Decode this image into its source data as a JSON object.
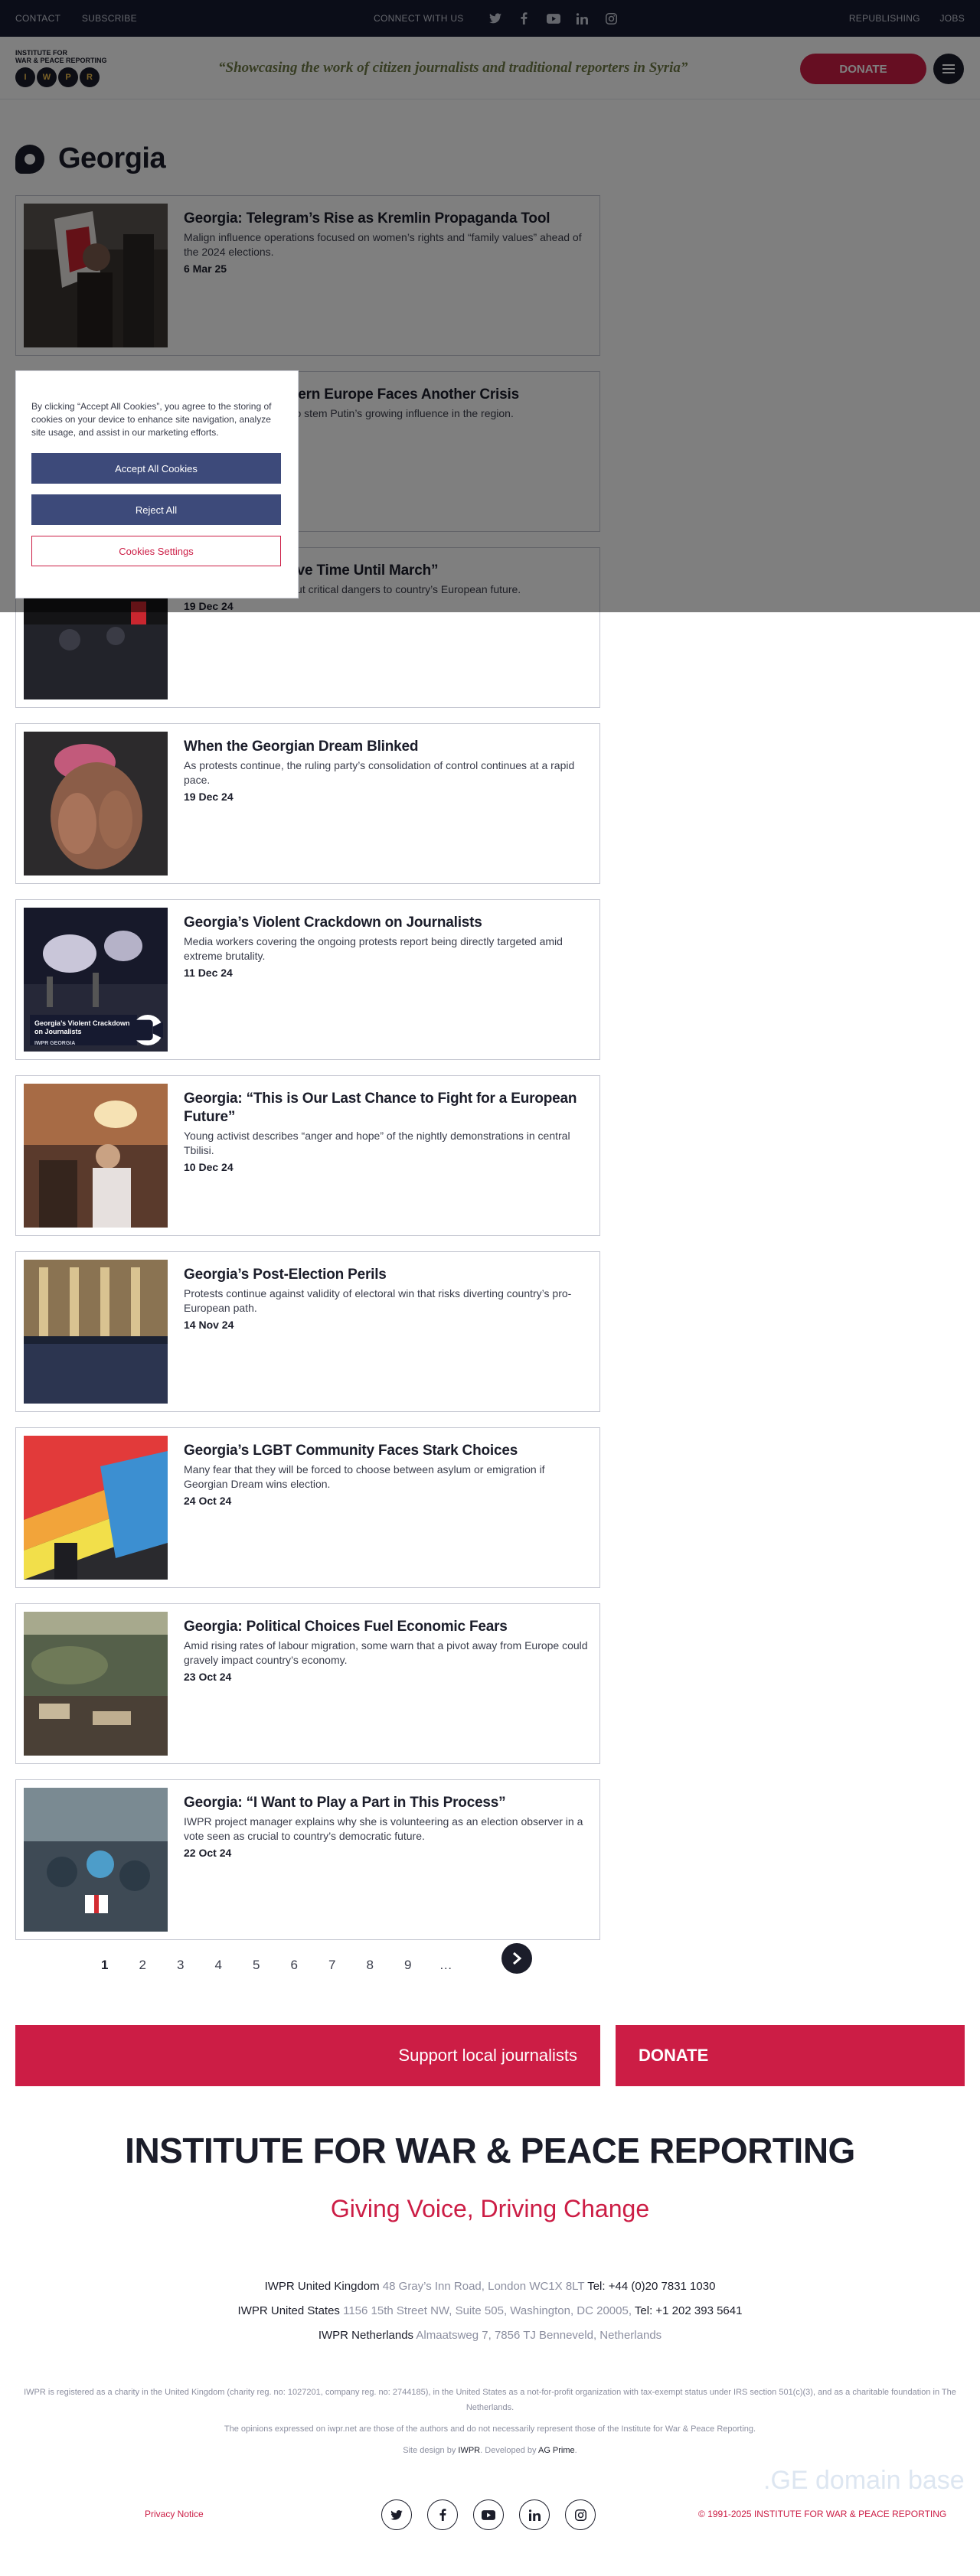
{
  "topbar": {
    "contact": "CONTACT",
    "subscribe": "SUBSCRIBE",
    "connect": "CONNECT WITH US",
    "republishing": "REPUBLISHING",
    "jobs": "JOBS"
  },
  "header": {
    "logo_line1": "INSTITUTE FOR",
    "logo_line2": "WAR & PEACE REPORTING",
    "logo_letters": [
      "I",
      "W",
      "P",
      "R"
    ],
    "tagline": "“Showcasing the work of citizen journalists and traditional reporters in Syria”",
    "donate": "DONATE"
  },
  "page": {
    "title": "Georgia"
  },
  "articles": [
    {
      "title": "Georgia: Telegram’s Rise as Kremlin Propaganda Tool",
      "summary": "Malign influence operations focused on women’s rights and “family values” ahead of the 2024 elections.",
      "date": "6 Mar 25"
    },
    {
      "title": "Georgia: As Eastern Europe Faces Another Crisis",
      "summary": "Local actors are trying to stem Putin’s growing influence in the region.",
      "date": ""
    },
    {
      "title": "Georgia: “We Have Time Until March”",
      "summary": "Former president lays out critical dangers to country’s European future.",
      "date": "19 Dec 24"
    },
    {
      "title": "When the Georgian Dream Blinked",
      "summary": "As protests continue, the ruling party’s consolidation of control continues at a rapid pace.",
      "date": "19 Dec 24"
    },
    {
      "title": "Georgia’s Violent Crackdown on Journalists",
      "summary": "Media workers covering the ongoing protests report being directly targeted amid extreme brutality.",
      "date": "11 Dec 24",
      "video_label": "Georgia’s Violent Crackdown on Journalists",
      "video_sub": "IWPR GEORGIA"
    },
    {
      "title": "Georgia: “This is Our Last Chance to Fight for a European Future”",
      "summary": "Young activist describes “anger and hope” of the nightly demonstrations in central Tbilisi.",
      "date": "10 Dec 24"
    },
    {
      "title": "Georgia’s Post-Election Perils",
      "summary": "Protests continue against validity of electoral win that risks diverting country’s pro-European path.",
      "date": "14 Nov 24"
    },
    {
      "title": "Georgia’s LGBT Community Faces Stark Choices",
      "summary": "Many fear that they will be forced to choose between asylum or emigration if Georgian Dream wins election.",
      "date": "24 Oct 24"
    },
    {
      "title": "Georgia: Political Choices Fuel Economic Fears",
      "summary": "Amid rising rates of labour migration, some warn that a pivot away from Europe could gravely impact country’s economy.",
      "date": "23 Oct 24"
    },
    {
      "title": "Georgia: “I Want to Play a Part in This Process”",
      "summary": "IWPR project manager explains why she is volunteering as an election observer in a vote seen as crucial to country’s democratic future.",
      "date": "22 Oct 24"
    }
  ],
  "pagination": {
    "pages": [
      "1",
      "2",
      "3",
      "4",
      "5",
      "6",
      "7",
      "8",
      "9",
      "…"
    ],
    "active": "1"
  },
  "banner": {
    "support": "Support local journalists",
    "donate": "DONATE"
  },
  "footer": {
    "org": "INSTITUTE FOR WAR & PEACE REPORTING",
    "slogan": "Giving Voice, Driving Change",
    "offices": [
      {
        "name": "IWPR United Kingdom",
        "address": "48 Gray’s Inn Road, London WC1X 8LT",
        "phone": "Tel: +44 (0)20 7831 1030"
      },
      {
        "name": "IWPR United States",
        "address": "1156 15th Street NW, Suite 505, Washington, DC 20005,",
        "phone": "Tel: +1 202 393 5641"
      },
      {
        "name": "IWPR Netherlands",
        "address": "Almaatsweg 7, 7856 TJ Benneveld, Netherlands",
        "phone": ""
      }
    ],
    "registration": "IWPR is registered as a charity in the United Kingdom (charity reg. no: 1027201, company reg. no: 2744185), in the United States as a not-for-profit organization with tax-exempt status under IRS section 501(c)(3), and as a charitable foundation in The Netherlands.",
    "opinions": "The opinions expressed on iwpr.net are those of the authors and do not necessarily represent those of the Institute for War & Peace Reporting.",
    "credits_prefix": "Site design by ",
    "credits_iwpr": "IWPR",
    "credits_mid": ". Developed by ",
    "credits_dev": "AG Prime",
    "credits_suffix": ".",
    "watermark": ".GE domain base",
    "privacy": "Privacy Notice",
    "copyright": "© 1991-2025 INSTITUTE FOR WAR & PEACE REPORTING"
  },
  "cookie": {
    "text": "By clicking “Accept All Cookies”, you agree to the storing of cookies on your device to enhance site navigation, analyze site usage, and assist in our marketing efforts.",
    "accept": "Accept All Cookies",
    "reject": "Reject All",
    "settings": "Cookies Settings"
  },
  "colors": {
    "navy": "#161a30",
    "brand_red": "#cc1d45",
    "cookie_button": "#3d4a7a"
  }
}
